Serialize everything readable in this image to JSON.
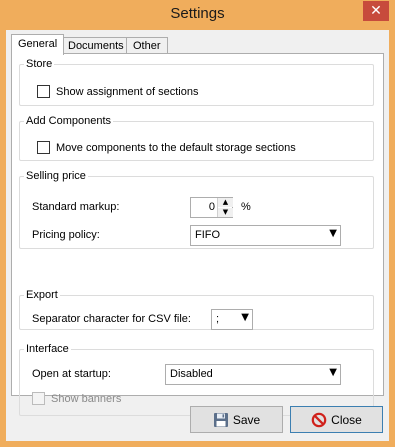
{
  "window": {
    "title": "Settings",
    "close_glyph": "✕"
  },
  "tabs": [
    {
      "label": "General",
      "active": true
    },
    {
      "label": "Documents",
      "active": false
    },
    {
      "label": "Other",
      "active": false
    }
  ],
  "store": {
    "legend": "Store",
    "show_assignment_label": "Show assignment of sections",
    "show_assignment_checked": false
  },
  "add_components": {
    "legend": "Add Components",
    "move_label": "Move components to the default storage sections",
    "move_checked": false
  },
  "selling_price": {
    "legend": "Selling price",
    "markup_label": "Standard markup:",
    "markup_value": "0",
    "markup_unit": "%",
    "policy_label": "Pricing policy:",
    "policy_value": "FIFO"
  },
  "export": {
    "legend": "Export",
    "separator_label": "Separator character for CSV file:",
    "separator_value": ";"
  },
  "interface": {
    "legend": "Interface",
    "startup_label": "Open at startup:",
    "startup_value": "Disabled",
    "banners_label": "Show banners",
    "banners_checked": false,
    "banners_enabled": false
  },
  "buttons": {
    "save": "Save",
    "close": "Close"
  },
  "icons": {
    "save": "floppy-disk-icon",
    "close": "no-entry-icon",
    "spin_up": "▲",
    "spin_down": "▼",
    "dropdown": "▼"
  }
}
